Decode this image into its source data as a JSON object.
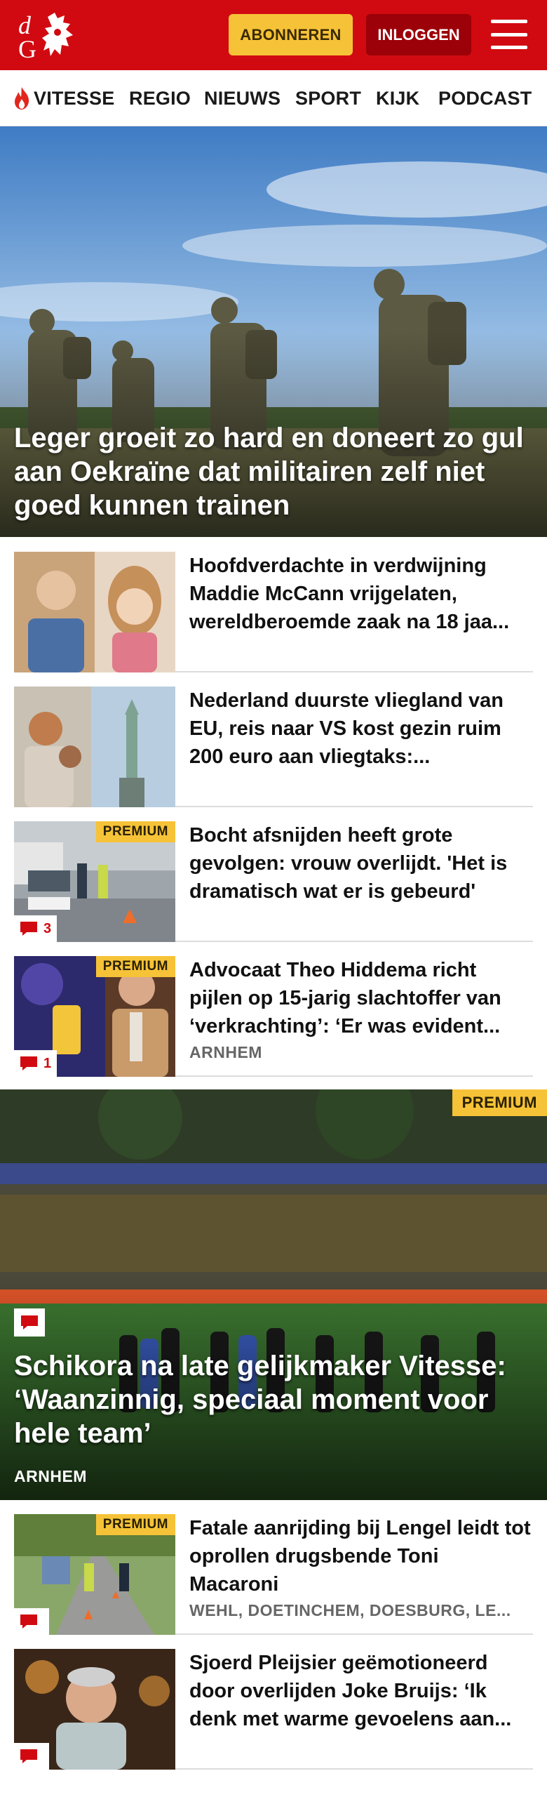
{
  "header": {
    "subscribe_label": "ABONNEREN",
    "login_label": "INLOGGEN",
    "brand_color": "#d10a11"
  },
  "nav": {
    "items": [
      "VITESSE",
      "REGIO",
      "NIEUWS",
      "SPORT",
      "KIJK",
      "PODCAST"
    ]
  },
  "hero": {
    "title": "Leger groeit zo hard en doneert zo gul aan Oekraïne dat militairen zelf niet goed kunnen trainen"
  },
  "articles": [
    {
      "title": "Hoofdverdachte in verdwijning Maddie McCann vrijgelaten, wereldberoemde zaak na 18 jaa...",
      "premium": "",
      "comments": "",
      "location": ""
    },
    {
      "title": "Nederland duurste vliegland van EU, reis naar VS kost gezin ruim 200 euro aan vliegtaks:...",
      "premium": "",
      "comments": "",
      "location": ""
    },
    {
      "title": "Bocht afsnijden heeft grote gevolgen: vrouw overlijdt. 'Het is dramatisch wat er is gebeurd'",
      "premium": "PREMIUM",
      "comments": "3",
      "location": ""
    },
    {
      "title": "Advocaat Theo Hiddema richt pijlen op 15-jarig slachtoffer van ‘verkrachting’: ‘Er was evident...",
      "premium": "PREMIUM",
      "comments": "1",
      "location": "ARNHEM"
    }
  ],
  "feature": {
    "title": "Schikora na late gelijkmaker Vitesse: ‘Waanzinnig, speciaal moment voor hele team’",
    "location": "ARNHEM",
    "premium": "PREMIUM"
  },
  "articles2": [
    {
      "title": "Fatale aanrijding bij Lengel leidt tot oprollen drugsbende Toni Macaroni",
      "premium": "PREMIUM",
      "location": "WEHL, DOETINCHEM, DOESBURG, LE..."
    },
    {
      "title": "Sjoerd Pleijsier geëmotioneerd door overlijden Joke Bruijs: ‘Ik denk met warme gevoelens aan...",
      "premium": "",
      "location": ""
    }
  ],
  "icons": {
    "logo": "dg-logo",
    "menu": "hamburger-icon",
    "flame": "flame-icon",
    "comment": "comment-icon"
  }
}
